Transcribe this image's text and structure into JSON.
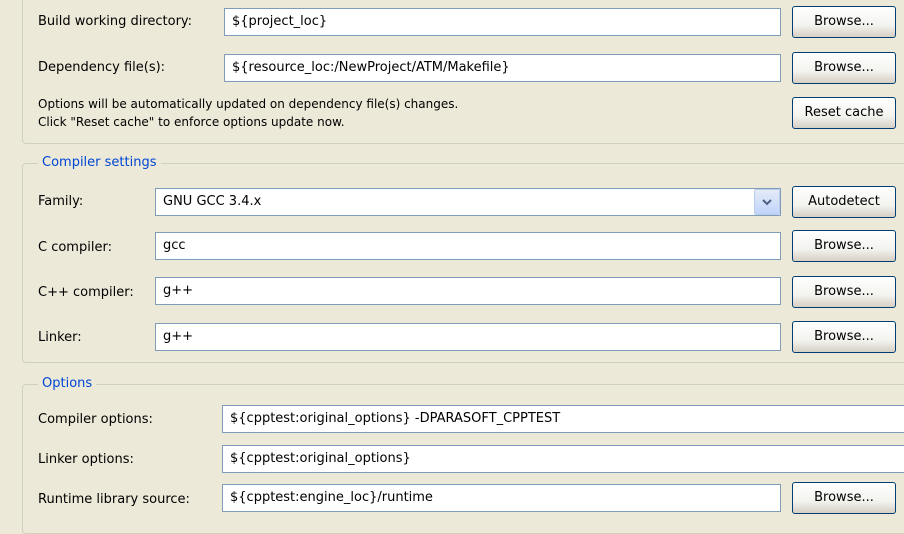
{
  "build_section": {
    "working_dir_label": "Build working directory:",
    "working_dir_value": "${project_loc}",
    "dependency_label": "Dependency file(s):",
    "dependency_value": "${resource_loc:/NewProject/ATM/Makefile}",
    "info_line1": "Options will be automatically updated on dependency file(s) changes.",
    "info_line2": "Click \"Reset cache\" to enforce options update now.",
    "browse_label": "Browse...",
    "reset_cache_label": "Reset cache"
  },
  "compiler_settings": {
    "title": "Compiler settings",
    "family_label": "Family:",
    "family_value": "GNU GCC 3.4.x",
    "autodetect_label": "Autodetect",
    "c_compiler_label": "C compiler:",
    "c_compiler_value": "gcc",
    "cpp_compiler_label": "C++ compiler:",
    "cpp_compiler_value": "g++",
    "linker_label": "Linker:",
    "linker_value": "g++",
    "browse_label": "Browse..."
  },
  "options": {
    "title": "Options",
    "compiler_options_label": "Compiler options:",
    "compiler_options_value": "${cpptest:original_options} -DPARASOFT_CPPTEST",
    "linker_options_label": "Linker options:",
    "linker_options_value": "${cpptest:original_options}",
    "runtime_label": "Runtime library source:",
    "runtime_value": "${cpptest:engine_loc}/runtime",
    "browse_label": "Browse..."
  },
  "colors": {
    "background": "#ece9d8",
    "group_title": "#0046d5",
    "field_border": "#7f9db9",
    "button_border": "#003c74"
  },
  "icons": {
    "combo_arrow": "chevron-down-icon"
  }
}
